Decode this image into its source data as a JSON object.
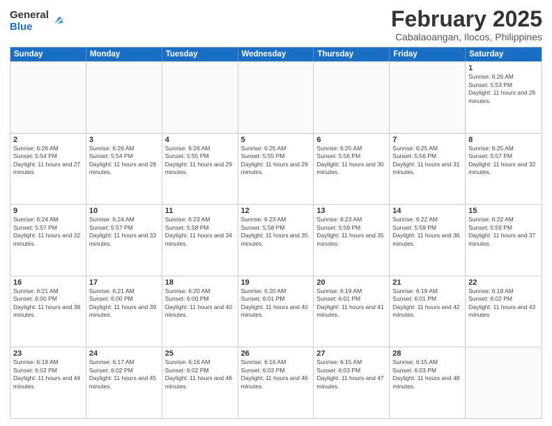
{
  "logo": {
    "general": "General",
    "blue": "Blue"
  },
  "title": "February 2025",
  "subtitle": "Cabalaoangan, Ilocos, Philippines",
  "weekdays": [
    "Sunday",
    "Monday",
    "Tuesday",
    "Wednesday",
    "Thursday",
    "Friday",
    "Saturday"
  ],
  "rows": [
    [
      {
        "day": "",
        "info": ""
      },
      {
        "day": "",
        "info": ""
      },
      {
        "day": "",
        "info": ""
      },
      {
        "day": "",
        "info": ""
      },
      {
        "day": "",
        "info": ""
      },
      {
        "day": "",
        "info": ""
      },
      {
        "day": "1",
        "info": "Sunrise: 6:26 AM\nSunset: 5:53 PM\nDaylight: 11 hours and 26 minutes."
      }
    ],
    [
      {
        "day": "2",
        "info": "Sunrise: 6:26 AM\nSunset: 5:54 PM\nDaylight: 11 hours and 27 minutes."
      },
      {
        "day": "3",
        "info": "Sunrise: 6:26 AM\nSunset: 5:54 PM\nDaylight: 11 hours and 28 minutes."
      },
      {
        "day": "4",
        "info": "Sunrise: 6:26 AM\nSunset: 5:55 PM\nDaylight: 11 hours and 29 minutes."
      },
      {
        "day": "5",
        "info": "Sunrise: 6:25 AM\nSunset: 5:55 PM\nDaylight: 11 hours and 29 minutes."
      },
      {
        "day": "6",
        "info": "Sunrise: 6:25 AM\nSunset: 5:56 PM\nDaylight: 11 hours and 30 minutes."
      },
      {
        "day": "7",
        "info": "Sunrise: 6:25 AM\nSunset: 5:56 PM\nDaylight: 11 hours and 31 minutes."
      },
      {
        "day": "8",
        "info": "Sunrise: 6:25 AM\nSunset: 5:57 PM\nDaylight: 11 hours and 32 minutes."
      }
    ],
    [
      {
        "day": "9",
        "info": "Sunrise: 6:24 AM\nSunset: 5:57 PM\nDaylight: 11 hours and 32 minutes."
      },
      {
        "day": "10",
        "info": "Sunrise: 6:24 AM\nSunset: 5:57 PM\nDaylight: 11 hours and 33 minutes."
      },
      {
        "day": "11",
        "info": "Sunrise: 6:23 AM\nSunset: 5:58 PM\nDaylight: 11 hours and 34 minutes."
      },
      {
        "day": "12",
        "info": "Sunrise: 6:23 AM\nSunset: 5:58 PM\nDaylight: 11 hours and 35 minutes."
      },
      {
        "day": "13",
        "info": "Sunrise: 6:23 AM\nSunset: 5:59 PM\nDaylight: 11 hours and 35 minutes."
      },
      {
        "day": "14",
        "info": "Sunrise: 6:22 AM\nSunset: 5:59 PM\nDaylight: 11 hours and 36 minutes."
      },
      {
        "day": "15",
        "info": "Sunrise: 6:22 AM\nSunset: 5:59 PM\nDaylight: 11 hours and 37 minutes."
      }
    ],
    [
      {
        "day": "16",
        "info": "Sunrise: 6:21 AM\nSunset: 6:00 PM\nDaylight: 11 hours and 38 minutes."
      },
      {
        "day": "17",
        "info": "Sunrise: 6:21 AM\nSunset: 6:00 PM\nDaylight: 11 hours and 39 minutes."
      },
      {
        "day": "18",
        "info": "Sunrise: 6:20 AM\nSunset: 6:00 PM\nDaylight: 11 hours and 40 minutes."
      },
      {
        "day": "19",
        "info": "Sunrise: 6:20 AM\nSunset: 6:01 PM\nDaylight: 11 hours and 40 minutes."
      },
      {
        "day": "20",
        "info": "Sunrise: 6:19 AM\nSunset: 6:01 PM\nDaylight: 11 hours and 41 minutes."
      },
      {
        "day": "21",
        "info": "Sunrise: 6:19 AM\nSunset: 6:01 PM\nDaylight: 11 hours and 42 minutes."
      },
      {
        "day": "22",
        "info": "Sunrise: 6:18 AM\nSunset: 6:02 PM\nDaylight: 11 hours and 43 minutes."
      }
    ],
    [
      {
        "day": "23",
        "info": "Sunrise: 6:18 AM\nSunset: 6:02 PM\nDaylight: 11 hours and 44 minutes."
      },
      {
        "day": "24",
        "info": "Sunrise: 6:17 AM\nSunset: 6:02 PM\nDaylight: 11 hours and 45 minutes."
      },
      {
        "day": "25",
        "info": "Sunrise: 6:16 AM\nSunset: 6:02 PM\nDaylight: 11 hours and 46 minutes."
      },
      {
        "day": "26",
        "info": "Sunrise: 6:16 AM\nSunset: 6:03 PM\nDaylight: 11 hours and 46 minutes."
      },
      {
        "day": "27",
        "info": "Sunrise: 6:15 AM\nSunset: 6:03 PM\nDaylight: 11 hours and 47 minutes."
      },
      {
        "day": "28",
        "info": "Sunrise: 6:15 AM\nSunset: 6:03 PM\nDaylight: 11 hours and 48 minutes."
      },
      {
        "day": "",
        "info": ""
      }
    ]
  ]
}
